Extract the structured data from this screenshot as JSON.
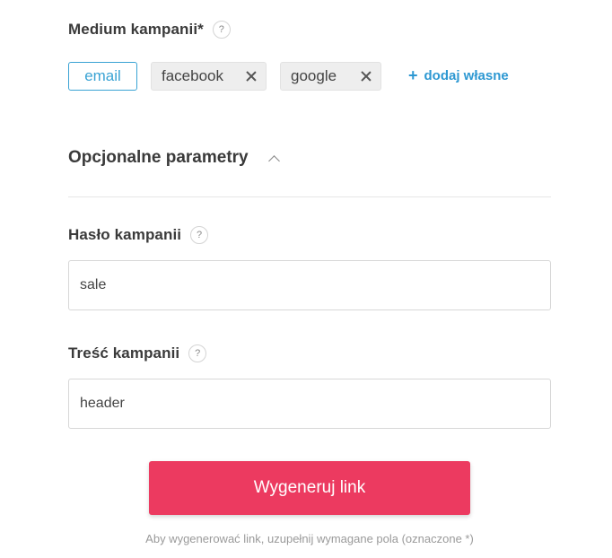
{
  "medium": {
    "label": "Medium kampanii*",
    "help": "?",
    "chips": [
      {
        "text": "email",
        "selected": true
      },
      {
        "text": "facebook",
        "selected": false,
        "removable": true
      },
      {
        "text": "google",
        "selected": false,
        "removable": true
      }
    ],
    "add_own": "dodaj własne",
    "add_icon": "+"
  },
  "optional": {
    "title": "Opcjonalne parametry",
    "chevron": "chevron-up-icon"
  },
  "slogan": {
    "label": "Hasło kampanii",
    "help": "?",
    "value": "sale"
  },
  "content": {
    "label": "Treść kampanii",
    "help": "?",
    "value": "header"
  },
  "generate": {
    "button": "Wygeneruj link",
    "hint": "Aby wygenerować link, uzupełnij wymagane pola (oznaczone *)"
  },
  "colors": {
    "accent_blue": "#3aa3d4",
    "cta_pink": "#ec3a60"
  }
}
